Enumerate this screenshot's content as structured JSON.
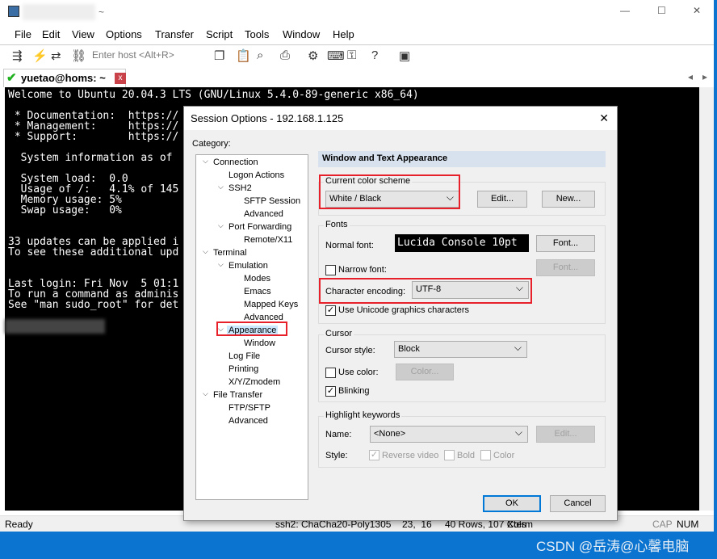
{
  "window": {
    "title_suffix": "~",
    "controls": {
      "minimize": "—",
      "maximize": "☐",
      "close": "✕"
    }
  },
  "menu": [
    "File",
    "Edit",
    "View",
    "Options",
    "Transfer",
    "Script",
    "Tools",
    "Window",
    "Help"
  ],
  "toolbar": {
    "host_placeholder": "Enter host <Alt+R>",
    "icons": [
      "connect-icon",
      "lightning-icon",
      "reconnect-icon",
      "link-icon",
      "copy-icon",
      "paste-icon",
      "find-icon",
      "print-icon",
      "settings-icon",
      "keymap-icon",
      "key-icon",
      "help-icon",
      "sftp-icon"
    ]
  },
  "tab": {
    "label": "yuetao@homs: ~",
    "close": "x",
    "nav_left": "◂",
    "nav_right": "▸"
  },
  "terminal": {
    "lines": [
      "Welcome to Ubuntu 20.04.3 LTS (GNU/Linux 5.4.0-89-generic x86_64)",
      "",
      " * Documentation:  https://",
      " * Management:     https://",
      " * Support:        https://",
      "",
      "  System information as of",
      "",
      "  System load:  0.0",
      "  Usage of /:   4.1% of 145",
      "  Memory usage: 5%",
      "  Swap usage:   0%",
      "",
      "",
      "33 updates can be applied i",
      "To see these additional upd",
      "",
      "",
      "Last login: Fri Nov  5 01:1",
      "To run a command as adminis",
      "See \"man sudo_root\" for det"
    ]
  },
  "status": {
    "ready": "Ready",
    "cipher": "ssh2: ChaCha20-Poly1305",
    "position": "23,  16",
    "size": "40 Rows, 107 Cols",
    "emulation": "Xterm",
    "cap": "CAP",
    "num": "NUM"
  },
  "watermark": "CSDN @岳涛@心馨电脑",
  "dialog": {
    "title": "Session Options - 192.168.1.125",
    "close": "✕",
    "category_label": "Category:",
    "tree": [
      {
        "label": "Connection",
        "level": 0,
        "expanded": true
      },
      {
        "label": "Logon Actions",
        "level": 1
      },
      {
        "label": "SSH2",
        "level": 1,
        "expanded": true
      },
      {
        "label": "SFTP Session",
        "level": 2
      },
      {
        "label": "Advanced",
        "level": 2
      },
      {
        "label": "Port Forwarding",
        "level": 1,
        "expanded": true
      },
      {
        "label": "Remote/X11",
        "level": 2
      },
      {
        "label": "Terminal",
        "level": 0,
        "expanded": true
      },
      {
        "label": "Emulation",
        "level": 1,
        "expanded": true
      },
      {
        "label": "Modes",
        "level": 2
      },
      {
        "label": "Emacs",
        "level": 2
      },
      {
        "label": "Mapped Keys",
        "level": 2
      },
      {
        "label": "Advanced",
        "level": 2
      },
      {
        "label": "Appearance",
        "level": 1,
        "expanded": true,
        "selected": true
      },
      {
        "label": "Window",
        "level": 2
      },
      {
        "label": "Log File",
        "level": 1
      },
      {
        "label": "Printing",
        "level": 1
      },
      {
        "label": "X/Y/Zmodem",
        "level": 1
      },
      {
        "label": "File Transfer",
        "level": 0,
        "expanded": true
      },
      {
        "label": "FTP/SFTP",
        "level": 1
      },
      {
        "label": "Advanced",
        "level": 1
      }
    ],
    "header": "Window and Text Appearance",
    "color_scheme": {
      "group": "Current color scheme",
      "value": "White / Black",
      "edit": "Edit...",
      "new": "New..."
    },
    "fonts": {
      "group": "Fonts",
      "normal_label": "Normal font:",
      "normal_value": "Lucida Console 10pt",
      "font_btn": "Font...",
      "narrow_label": "Narrow font:",
      "narrow_checked": false,
      "narrow_btn": "Font...",
      "encoding_label": "Character encoding:",
      "encoding_value": "UTF-8",
      "unicode_label": "Use Unicode graphics characters",
      "unicode_checked": true
    },
    "cursor": {
      "group": "Cursor",
      "style_label": "Cursor style:",
      "style_value": "Block",
      "use_color_label": "Use color:",
      "use_color_checked": false,
      "color_btn": "Color...",
      "blinking_label": "Blinking",
      "blinking_checked": true
    },
    "highlight": {
      "group": "Highlight keywords",
      "name_label": "Name:",
      "name_value": "<None>",
      "edit": "Edit...",
      "style_label": "Style:",
      "reverse": "Reverse video",
      "bold": "Bold",
      "color": "Color"
    },
    "ok": "OK",
    "cancel": "Cancel"
  },
  "colors": {
    "accent": "#0078d7",
    "highlight_box": "#e8202a",
    "selection": "#cce8ff"
  }
}
